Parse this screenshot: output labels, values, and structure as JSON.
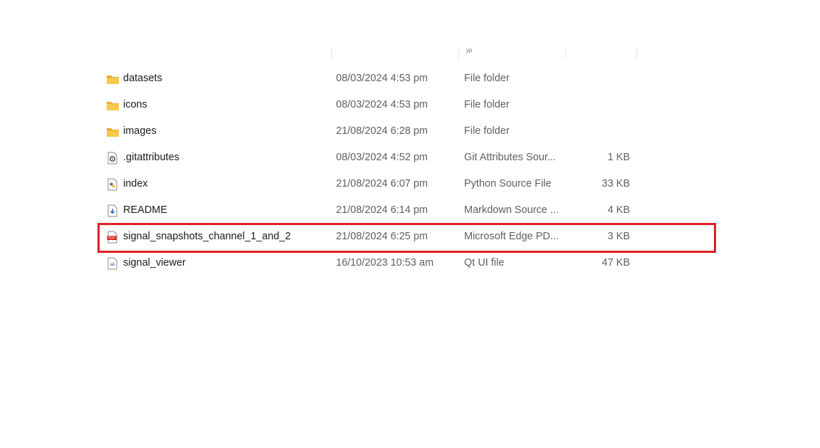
{
  "colors": {
    "folder": "#f7c948",
    "highlight": "#e01e24",
    "pdf": "#d9261c",
    "python": "#3b7bbf"
  },
  "files": [
    {
      "name": "datasets",
      "modified": "08/03/2024 4:53 pm",
      "type": "File folder",
      "size": "",
      "icon": "folder-icon"
    },
    {
      "name": "icons",
      "modified": "08/03/2024 4:53 pm",
      "type": "File folder",
      "size": "",
      "icon": "folder-icon"
    },
    {
      "name": "images",
      "modified": "21/08/2024 6:28 pm",
      "type": "File folder",
      "size": "",
      "icon": "folder-icon"
    },
    {
      "name": ".gitattributes",
      "modified": "08/03/2024 4:52 pm",
      "type": "Git Attributes Sour...",
      "size": "1 KB",
      "icon": "settings-file-icon"
    },
    {
      "name": "index",
      "modified": "21/08/2024 6:07 pm",
      "type": "Python Source File",
      "size": "33 KB",
      "icon": "python-file-icon"
    },
    {
      "name": "README",
      "modified": "21/08/2024 6:14 pm",
      "type": "Markdown Source ...",
      "size": "4 KB",
      "icon": "markdown-file-icon"
    },
    {
      "name": "signal_snapshots_channel_1_and_2",
      "modified": "21/08/2024 6:25 pm",
      "type": "Microsoft Edge PD...",
      "size": "3 KB",
      "icon": "pdf-file-icon"
    },
    {
      "name": "signal_viewer",
      "modified": "16/10/2023 10:53 am",
      "type": "Qt UI file",
      "size": "47 KB",
      "icon": "ui-file-icon"
    }
  ]
}
